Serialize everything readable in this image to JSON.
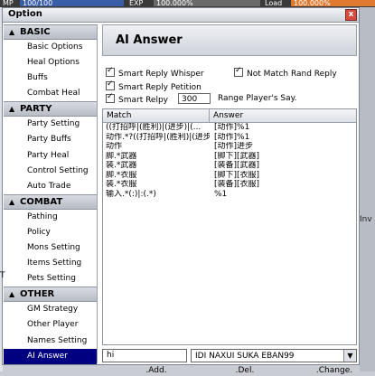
{
  "background": {
    "mp_label": "MP",
    "mp_value": "100/100",
    "exp_label": "EXP",
    "exp_value": "100.000%",
    "load_label": "Load",
    "load_value": "100.000%",
    "inv_label": "Inv",
    "edge_letter": "T"
  },
  "window": {
    "title": "Option",
    "close_label": "x"
  },
  "sidebar": {
    "categories": [
      {
        "label": "BASIC",
        "items": [
          "Basic Options",
          "Heal Options",
          "Buffs",
          "Combat Heal"
        ]
      },
      {
        "label": "PARTY",
        "items": [
          "Party Setting",
          "Party Buffs",
          "Party Heal",
          "Control Setting",
          "Auto Trade"
        ]
      },
      {
        "label": "COMBAT",
        "items": [
          "Pathing",
          "Policy",
          "Mons Setting",
          "Items Setting",
          "Pets Setting"
        ]
      },
      {
        "label": "OTHER",
        "items": [
          "GM Strategy",
          "Other Player",
          "Names Setting",
          "AI Answer"
        ]
      }
    ],
    "selected_item": "AI Answer"
  },
  "main": {
    "title": "AI Answer",
    "options": {
      "smart_reply_whisper": "Smart Reply Whisper",
      "not_match_rand_reply": "Not Match Rand Reply",
      "smart_reply_petition": "Smart Reply Petition",
      "smart_relpy": "Smart Relpy",
      "range_value": "300",
      "range_label": "Range Player's Say."
    },
    "table": {
      "columns": [
        "Match",
        "Answer"
      ],
      "rows": [
        [
          "((打招呼|(胜利)|(进步)|(...",
          "[动作]%1"
        ],
        [
          "动作.*?((打招呼|(胜利)|(进步)|(...",
          "[动作]%1"
        ],
        [
          "动作",
          "[动作]进步"
        ],
        [
          "脚.*武器",
          "[脚下][武器]"
        ],
        [
          "装.*武器",
          "[装备][武器]"
        ],
        [
          "脚.*衣服",
          "[脚下][衣服]"
        ],
        [
          "装.*衣服",
          "[装备][衣服]"
        ],
        [
          "输入.*(:)|:(.*)",
          "%1"
        ]
      ]
    },
    "input_value": "hi",
    "select_value": "IDI NAXUI SUKA EBAN99",
    "buttons": {
      "add": ".Add.",
      "del": ".Del.",
      "change": ".Change."
    }
  }
}
